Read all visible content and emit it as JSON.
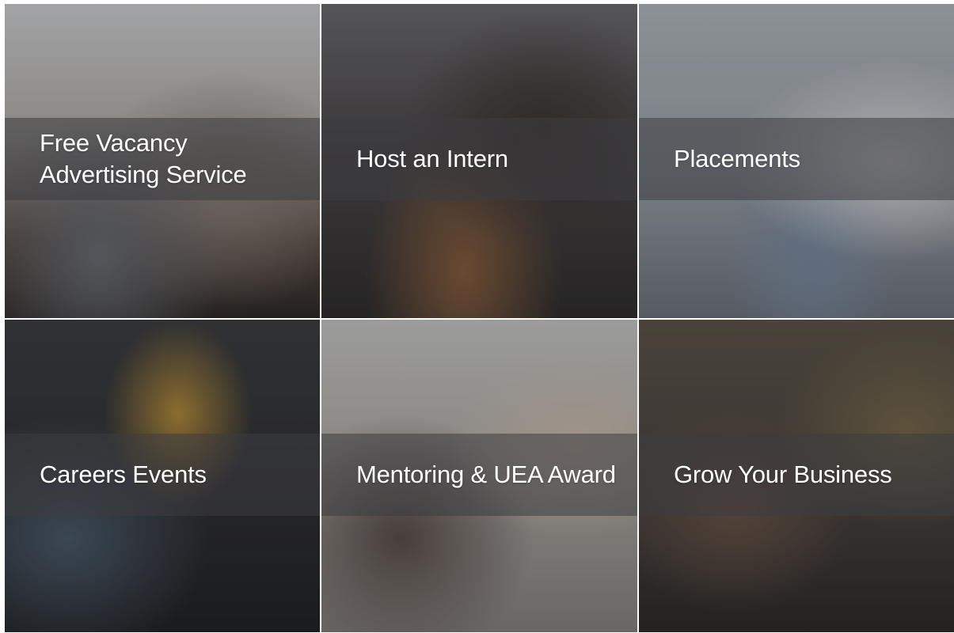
{
  "tiles": [
    {
      "label": "Free Vacancy Advertising Service",
      "photo": "students-with-laptops-queens-building"
    },
    {
      "label": "Host an Intern",
      "photo": "engineers-under-vehicle-with-clipboard"
    },
    {
      "label": "Placements",
      "photo": "scientist-in-lab-with-folder"
    },
    {
      "label": "Careers Events",
      "photo": "careers-fair-stands"
    },
    {
      "label": "Mentoring & UEA Award",
      "photo": "mentoring-office-meeting"
    },
    {
      "label": "Grow Your Business",
      "photo": "team-working-at-computer"
    }
  ]
}
